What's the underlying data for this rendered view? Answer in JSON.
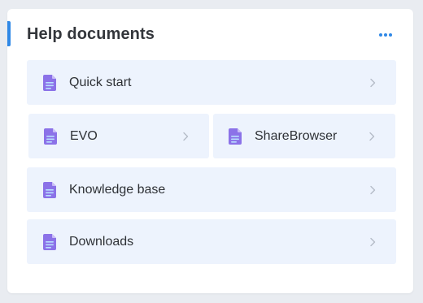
{
  "panel": {
    "title": "Help documents",
    "more_icon": "more-horizontal-icon",
    "accent_color": "#2f88e6"
  },
  "items": [
    {
      "label": "Quick start",
      "icon": "document-icon",
      "chevron": "chevron-right-icon"
    },
    {
      "label": "EVO",
      "icon": "document-icon",
      "chevron": "chevron-right-icon"
    },
    {
      "label": "ShareBrowser",
      "icon": "document-icon",
      "chevron": "chevron-right-icon"
    },
    {
      "label": "Knowledge base",
      "icon": "document-icon",
      "chevron": "chevron-right-icon"
    },
    {
      "label": "Downloads",
      "icon": "document-icon",
      "chevron": "chevron-right-icon"
    }
  ],
  "colors": {
    "item_background": "#edf3fd",
    "icon_purple": "#8b72e8",
    "icon_purple_light": "#b7a8f3"
  }
}
